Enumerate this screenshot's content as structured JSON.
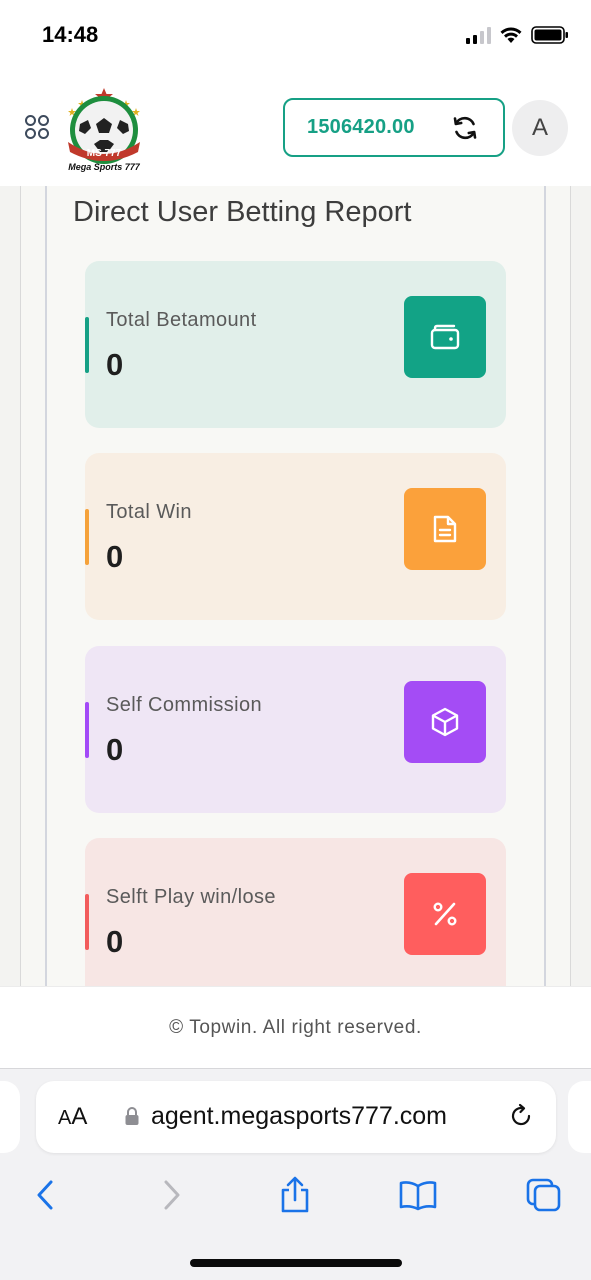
{
  "status_bar": {
    "time": "14:48"
  },
  "header": {
    "logo_text": "Mega Sports 777",
    "logo_badge": "MS 777",
    "balance": "1506420.00",
    "avatar_letter": "A"
  },
  "report": {
    "title": "Direct User Betting Report",
    "cards": [
      {
        "label": "Total Betamount",
        "value": "0",
        "icon": "wallet-icon",
        "accent": "#16a085",
        "bg": "#e1efea",
        "icon_bg": "#12a386"
      },
      {
        "label": "Total Win",
        "value": "0",
        "icon": "document-icon",
        "accent": "#f5a23a",
        "bg": "#f8eee3",
        "icon_bg": "#fba13b"
      },
      {
        "label": "Self Commission",
        "value": "0",
        "icon": "cube-icon",
        "accent": "#a34af7",
        "bg": "#efe6f5",
        "icon_bg": "#a44cf5"
      },
      {
        "label": "Selft Play win/lose",
        "value": "0",
        "icon": "percent-icon",
        "accent": "#f25c5c",
        "bg": "#f7e6e4",
        "icon_bg": "#ff5e5e"
      }
    ]
  },
  "footer": {
    "copyright": "© Topwin. All right reserved."
  },
  "browser": {
    "aa_label_small": "A",
    "aa_label_big": "A",
    "url": "agent.megasports777.com",
    "accent": "#1a73e8"
  }
}
